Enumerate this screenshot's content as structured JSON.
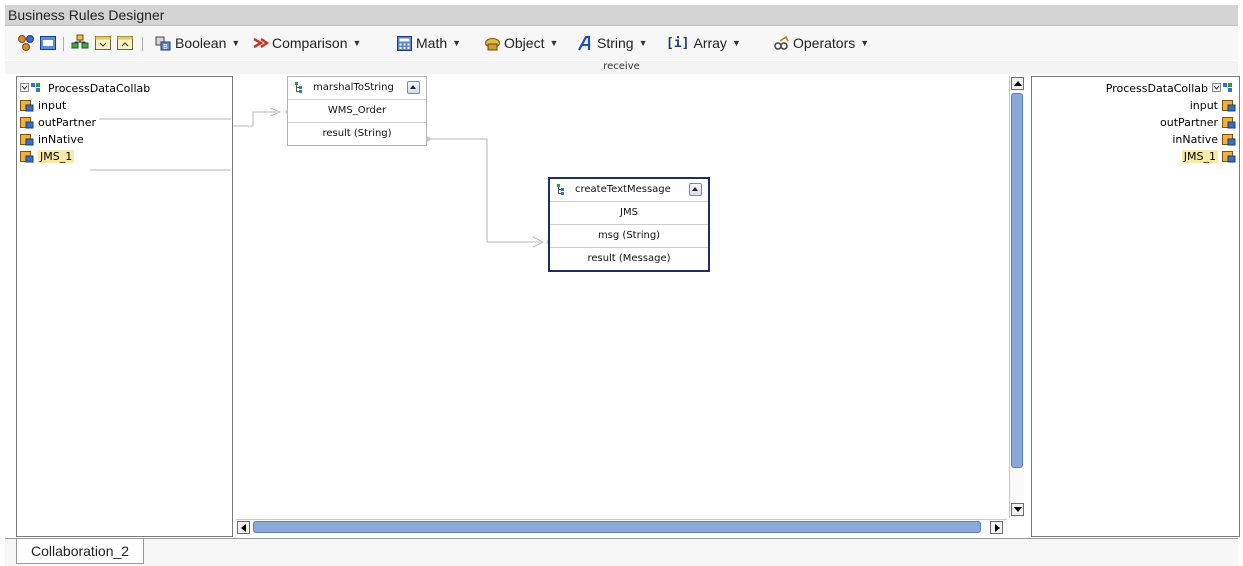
{
  "window": {
    "title": "Business Rules Designer"
  },
  "toolbar": {
    "icons": [
      "show-hide-panels-icon",
      "display-icon",
      "layout-icon",
      "expand-all-icon",
      "collapse-all-icon"
    ],
    "menus": [
      {
        "id": "boolean",
        "label": "Boolean",
        "icon": "boolean-icon"
      },
      {
        "id": "comparison",
        "label": "Comparison",
        "icon": "comparison-icon"
      },
      {
        "id": "math",
        "label": "Math",
        "icon": "math-icon"
      },
      {
        "id": "object",
        "label": "Object",
        "icon": "object-icon"
      },
      {
        "id": "string",
        "label": "String",
        "icon": "string-icon"
      },
      {
        "id": "array",
        "label": "Array",
        "icon": "array-icon",
        "icon_text": "[i]"
      },
      {
        "id": "operators",
        "label": "Operators",
        "icon": "operators-icon"
      }
    ]
  },
  "canvas": {
    "method_label": "receive"
  },
  "left_tree": {
    "root": "ProcessDataCollab",
    "items": [
      "input",
      "outPartner",
      "inNative",
      "JMS_1"
    ],
    "selected": "JMS_1"
  },
  "right_tree": {
    "root": "ProcessDataCollab",
    "items": [
      "input",
      "outPartner",
      "inNative",
      "JMS_1"
    ],
    "selected": "JMS_1"
  },
  "methods": {
    "marshal": {
      "name": "marshalToString",
      "rows": [
        "WMS_Order",
        "result (String)"
      ]
    },
    "create": {
      "name": "createTextMessage",
      "rows": [
        "JMS",
        "msg (String)",
        "result (Message)"
      ]
    }
  },
  "tabs": {
    "active": "Collaboration_2"
  },
  "colors": {
    "selection": "#fde9a6",
    "active_border": "#1f2e68",
    "scroll_thumb": "#8aa8d8"
  }
}
